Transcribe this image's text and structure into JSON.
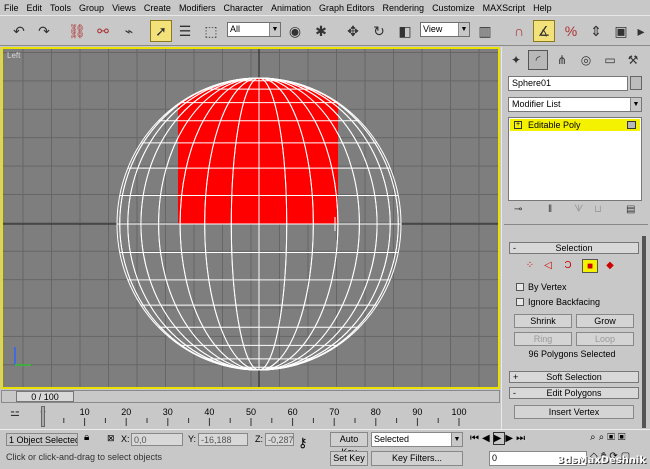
{
  "menu": [
    "File",
    "Edit",
    "Tools",
    "Group",
    "Views",
    "Create",
    "Modifiers",
    "Character",
    "Animation",
    "Graph Editors",
    "Rendering",
    "Customize",
    "MAXScript",
    "Help"
  ],
  "toolbar": {
    "selection_filter": "All",
    "ref_coord": "View",
    "icons": [
      "undo-icon",
      "redo-icon",
      "select-and-link-icon",
      "unlink-icon",
      "bind-space-warp-icon",
      "select-object-icon",
      "select-by-name-icon",
      "rect-selection-region-icon",
      "window-crossing-icon",
      "select-move-icon",
      "select-rotate-icon",
      "select-scale-icon",
      "use-pivot-center-icon",
      "select-manipulate-icon",
      "snaps-toggle-icon",
      "angle-snap-icon",
      "percent-snap-icon",
      "spinner-snap-icon",
      "named-selection-icon",
      "mirror-icon",
      "align-icon",
      "layer-manager-icon",
      "curve-editor-icon",
      "schematic-view-icon",
      "material-editor-icon",
      "render-scene-icon",
      "quick-render-icon"
    ]
  },
  "viewport": {
    "label": "Left"
  },
  "time_slider": {
    "value": "0 / 100"
  },
  "track_bar": {
    "ticks": [
      "0",
      "10",
      "20",
      "30",
      "40",
      "50",
      "60",
      "70",
      "80",
      "90",
      "100"
    ]
  },
  "status": {
    "selected_count": "1 Object Selected",
    "x_label": "X:",
    "x_value": "0,0",
    "y_label": "Y:",
    "y_value": "-16,188",
    "z_label": "Z:",
    "z_value": "-0,287",
    "auto_key": "Auto Key",
    "set_key": "Set Key",
    "key_mode": "Selected",
    "key_filters": "Key Filters...",
    "frame": "0",
    "prompt": "Click or click-and-drag to select objects"
  },
  "command_panel": {
    "object_name": "Sphere01",
    "modifier_list": "Modifier List",
    "stack_item": "Editable Poly",
    "selection": {
      "title": "Selection",
      "by_vertex": "By Vertex",
      "ignore_backfacing": "Ignore Backfacing",
      "shrink": "Shrink",
      "grow": "Grow",
      "ring": "Ring",
      "loop": "Loop",
      "status": "96 Polygons Selected"
    },
    "soft_selection": "Soft Selection",
    "edit_polygons": "Edit Polygons",
    "insert_vertex": "Insert Vertex"
  },
  "watermark": "3dsMaxDeshnik",
  "colors": {
    "viewport_border": "#e9e000",
    "selected_poly": "#ff0000",
    "grid_bg": "#7e7e7e"
  }
}
